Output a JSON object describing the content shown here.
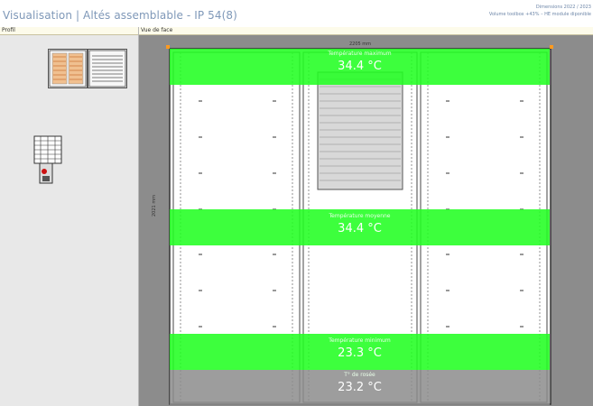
{
  "window": {
    "title": "Visualisation | Altés assemblable - IP 54(8)",
    "status_line1": "Dimensions 2022 / 2023",
    "status_line2": "Volume toolbox +43% – HE module diponible"
  },
  "left_panel": {
    "header": "Profil"
  },
  "right_panel": {
    "header": "Vue de face"
  },
  "dimensions": {
    "width": "2205 mm",
    "height": "2021 mm"
  },
  "temperatures": {
    "max": {
      "label": "Température maximum",
      "value": "34.4 °C"
    },
    "avg": {
      "label": "Température moyenne",
      "value": "34.4 °C"
    },
    "min": {
      "label": "Température minimum",
      "value": "23.3 °C"
    },
    "dew": {
      "label": "T° de rosée",
      "value": "23.2 °C"
    }
  },
  "colors": {
    "highlight_green": "#22ff22",
    "title_blue": "#7f98b8",
    "frame_orange": "#ff9a1f"
  }
}
